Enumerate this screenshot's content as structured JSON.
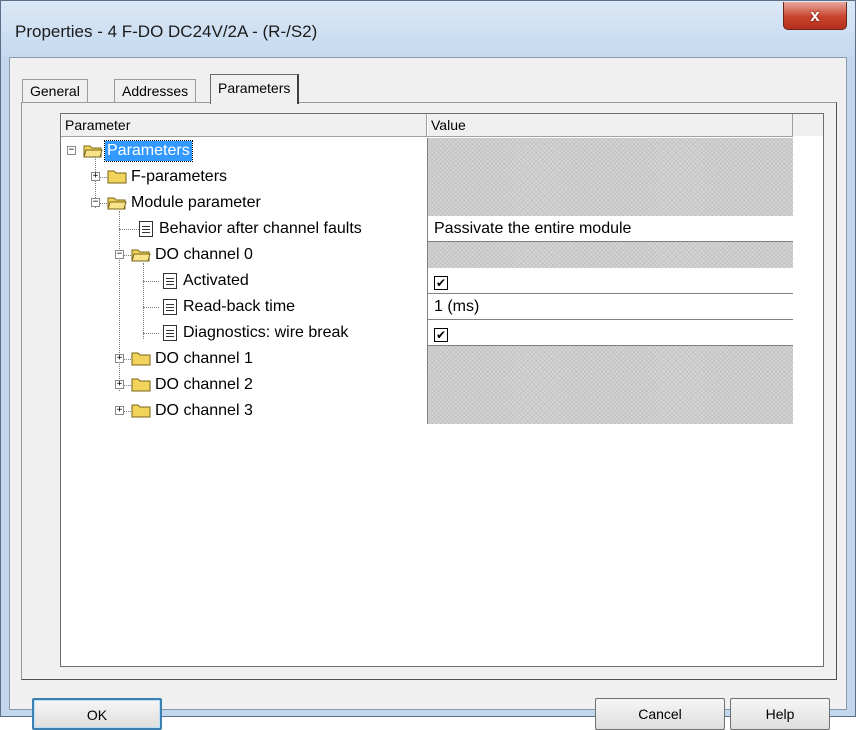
{
  "window": {
    "title": "Properties - 4 F-DO DC24V/2A - (R-/S2)",
    "close_glyph": "x"
  },
  "tabs": [
    {
      "label": "General"
    },
    {
      "label": "Addresses"
    },
    {
      "label": "Parameters"
    }
  ],
  "grid": {
    "col_parameter": "Parameter",
    "col_value": "Value",
    "rows": [
      {
        "label": "Parameters"
      },
      {
        "label": "F-parameters"
      },
      {
        "label": "Module parameter"
      },
      {
        "label": "Behavior after channel faults",
        "value": "Passivate the entire module"
      },
      {
        "label": "DO channel 0"
      },
      {
        "label": "Activated",
        "checked": true
      },
      {
        "label": "Read-back time",
        "value": "1 (ms)"
      },
      {
        "label": "Diagnostics: wire break",
        "checked": true
      },
      {
        "label": "DO channel 1"
      },
      {
        "label": "DO channel 2"
      },
      {
        "label": "DO channel 3"
      }
    ],
    "expanded_glyph": "−",
    "collapsed_glyph": "+",
    "check_glyph": "✔"
  },
  "buttons": {
    "ok": "OK",
    "cancel": "Cancel",
    "help": "Help"
  },
  "colors": {
    "selection": "#3399ff",
    "folder": "#f2d35c"
  }
}
